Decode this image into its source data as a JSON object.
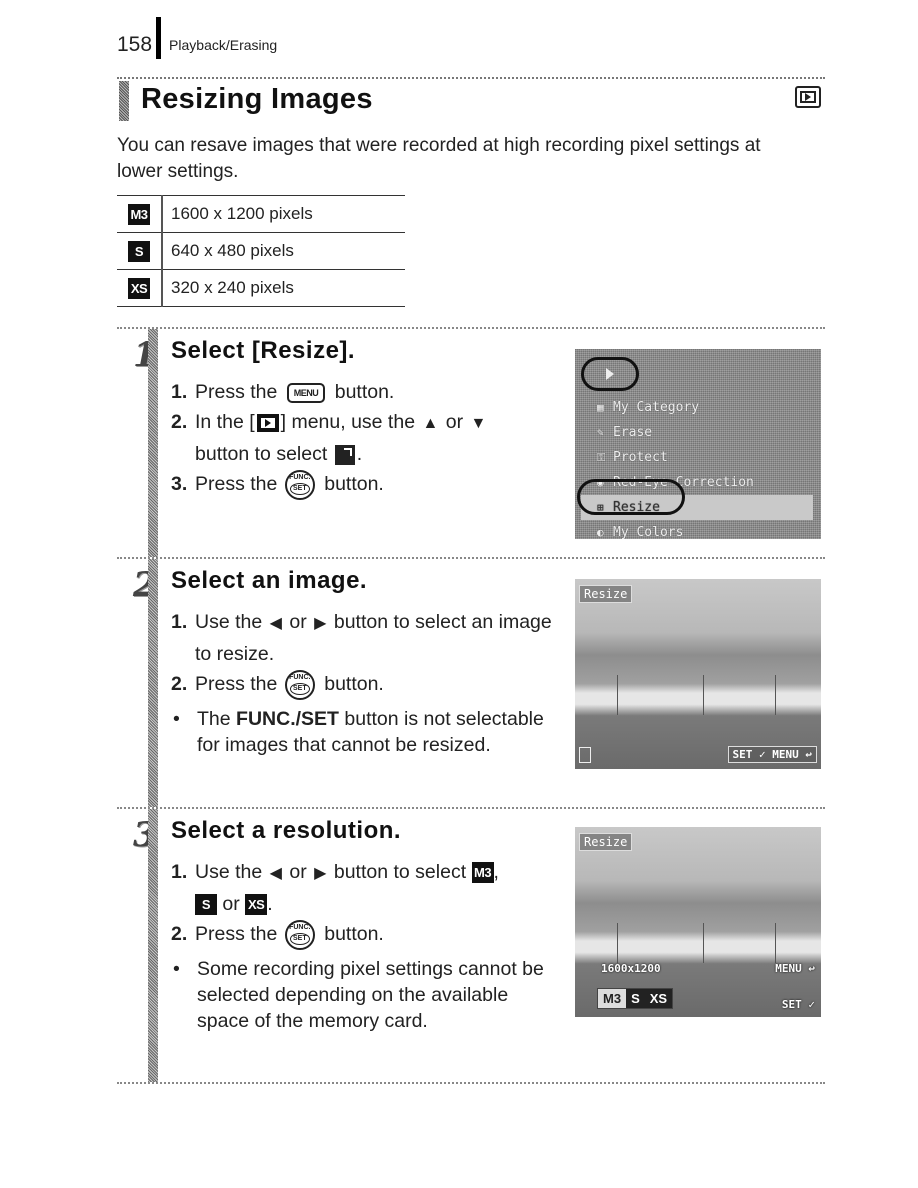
{
  "header": {
    "page_number": "158",
    "section": "Playback/Erasing"
  },
  "title": {
    "text": "Resizing Images",
    "mode_icon": "playback-icon"
  },
  "intro": "You can resave images that were recorded at high recording pixel settings at lower settings.",
  "resolutions": [
    {
      "badge": "M3",
      "value": "1600 x 1200 pixels"
    },
    {
      "badge": "S",
      "value": "640 x 480 pixels"
    },
    {
      "badge": "XS",
      "value": "320 x 240 pixels"
    }
  ],
  "steps": [
    {
      "number": "1",
      "title": "Select [Resize].",
      "items": [
        {
          "n": "1.",
          "pre": "Press the",
          "button": "MENU",
          "post": "button."
        },
        {
          "n": "2.",
          "pre": "In the [",
          "mid": "] menu, use the",
          "up": "▲",
          "or": "or",
          "down": "▼",
          "line2": "button to select",
          "end": "."
        },
        {
          "n": "3.",
          "pre": "Press the",
          "func_top": "FUNC.",
          "func_bottom": "SET",
          "post": "button."
        }
      ],
      "screen": {
        "menu_items": [
          {
            "icon": "▦",
            "label": "My Category"
          },
          {
            "icon": "✎",
            "label": "Erase"
          },
          {
            "icon": "⚿",
            "label": "Protect"
          },
          {
            "icon": "◉",
            "label": "Red-Eye Correction"
          },
          {
            "icon": "⊞",
            "label": "Resize",
            "selected": true
          },
          {
            "icon": "◐",
            "label": "My Colors"
          }
        ]
      }
    },
    {
      "number": "2",
      "title": "Select an image.",
      "items": [
        {
          "n": "1.",
          "pre": "Use the",
          "left": "◀",
          "or": "or",
          "right": "▶",
          "post": "button to select an image to resize."
        },
        {
          "n": "2.",
          "pre": "Press the",
          "func_top": "FUNC.",
          "func_bottom": "SET",
          "post": "button."
        }
      ],
      "note": {
        "bold": "FUNC./SET",
        "pre": "The",
        "post": "button is not selectable for images that cannot be resized."
      },
      "screen": {
        "title": "Resize",
        "footer": "SET ✓ MENU ↩"
      }
    },
    {
      "number": "3",
      "title": "Select a resolution.",
      "items": [
        {
          "n": "1.",
          "pre": "Use the",
          "left": "◀",
          "or": "or",
          "right": "▶",
          "post": "button to select",
          "badge1": "M3",
          "comma": ",",
          "badge2": "S",
          "or2": "or",
          "badge3": "XS",
          "end": "."
        },
        {
          "n": "2.",
          "pre": "Press the",
          "func_top": "FUNC.",
          "func_bottom": "SET",
          "post": "button."
        }
      ],
      "note": {
        "text": "Some recording pixel settings cannot be selected depending on the available space of the memory card."
      },
      "screen": {
        "title": "Resize",
        "size_label": "1600x1200",
        "menu_label": "MENU ↩",
        "set_label": "SET ✓",
        "options": [
          "M3",
          "S",
          "XS"
        ],
        "selected": "M3"
      }
    }
  ]
}
